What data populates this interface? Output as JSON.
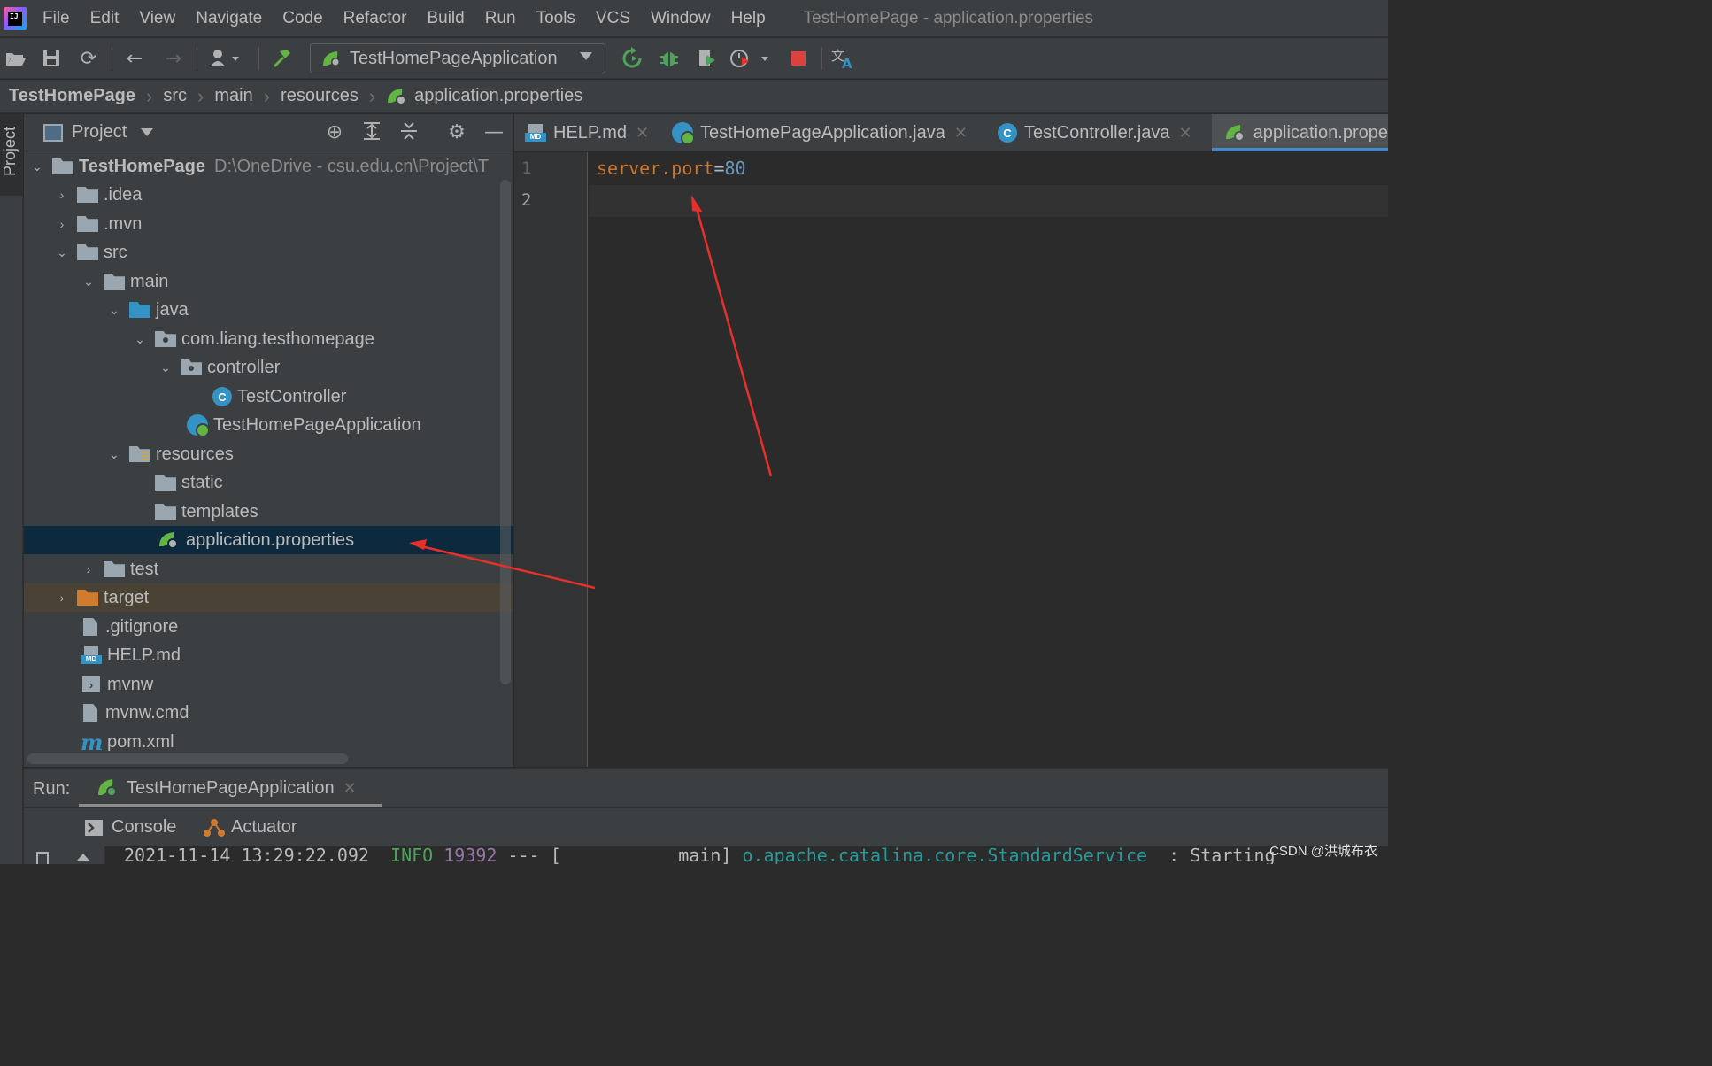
{
  "menu": {
    "items": [
      "File",
      "Edit",
      "View",
      "Navigate",
      "Code",
      "Refactor",
      "Build",
      "Run",
      "Tools",
      "VCS",
      "Window",
      "Help"
    ],
    "window_title": "TestHomePage - application.properties"
  },
  "toolbar": {
    "run_config": "TestHomePageApplication"
  },
  "breadcrumb": [
    "TestHomePage",
    "src",
    "main",
    "resources",
    "application.properties"
  ],
  "left_strip": {
    "project_label": "Project"
  },
  "project_panel": {
    "title": "Project",
    "tree": [
      {
        "label": "TestHomePage",
        "path": "D:\\OneDrive - csu.edu.cn\\Project\\T"
      },
      {
        "label": ".idea"
      },
      {
        "label": ".mvn"
      },
      {
        "label": "src"
      },
      {
        "label": "main"
      },
      {
        "label": "java"
      },
      {
        "label": "com.liang.testhomepage"
      },
      {
        "label": "controller"
      },
      {
        "label": "TestController"
      },
      {
        "label": "TestHomePageApplication"
      },
      {
        "label": "resources"
      },
      {
        "label": "static"
      },
      {
        "label": "templates"
      },
      {
        "label": "application.properties"
      },
      {
        "label": "test"
      },
      {
        "label": "target"
      },
      {
        "label": ".gitignore"
      },
      {
        "label": "HELP.md"
      },
      {
        "label": "mvnw"
      },
      {
        "label": "mvnw.cmd"
      },
      {
        "label": "pom.xml"
      }
    ]
  },
  "editor": {
    "tabs": [
      {
        "label": "HELP.md"
      },
      {
        "label": "TestHomePageApplication.java"
      },
      {
        "label": "TestController.java"
      },
      {
        "label": "application.prope"
      }
    ],
    "line_numbers": [
      "1",
      "2"
    ],
    "code": {
      "key": "server.port",
      "eq": "=",
      "value": "80"
    }
  },
  "run_panel": {
    "label": "Run:",
    "tab": "TestHomePageApplication",
    "subtabs": [
      "Console",
      "Actuator"
    ],
    "console": {
      "timestamp": "2021-11-14 13:29:22.092",
      "level": "INFO",
      "pid": "19392",
      "sep": "--- [",
      "thread": "main]",
      "logger": "o.apache.catalina.core.StandardService",
      "msg": ": Starting"
    }
  },
  "watermark": "CSDN @洪城布衣",
  "colors": {
    "accent": "#4a88c7",
    "selection": "#0d293e",
    "annotation_arrow": "#e8302a",
    "keyword": "#cc7832",
    "number": "#6897bb"
  }
}
